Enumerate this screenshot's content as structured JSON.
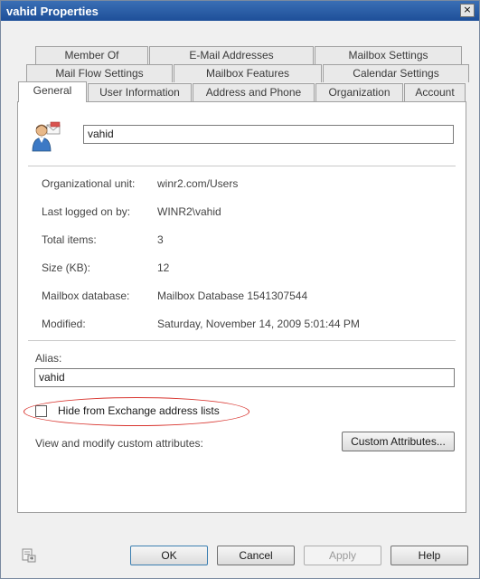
{
  "window": {
    "title": "vahid Properties",
    "close_glyph": "×"
  },
  "tabs": {
    "row1": [
      "Member Of",
      "E-Mail Addresses",
      "Mailbox Settings"
    ],
    "row2": [
      "Mail Flow Settings",
      "Mailbox Features",
      "Calendar Settings"
    ],
    "row3": [
      "General",
      "User Information",
      "Address and Phone",
      "Organization",
      "Account"
    ],
    "active": "General"
  },
  "general": {
    "display_name": "vahid",
    "fields": [
      {
        "label": "Organizational unit:",
        "value": "winr2.com/Users"
      },
      {
        "label": "Last logged on by:",
        "value": "WINR2\\vahid"
      },
      {
        "label": "Total items:",
        "value": "3"
      },
      {
        "label": "Size (KB):",
        "value": "12"
      },
      {
        "label": "Mailbox database:",
        "value": "Mailbox Database 1541307544"
      },
      {
        "label": "Modified:",
        "value": "Saturday, November 14, 2009 5:01:44 PM"
      }
    ],
    "alias_label": "Alias:",
    "alias_value": "vahid",
    "hide_checkbox_label": "Hide from Exchange address lists",
    "hide_checked": false,
    "custom_attr_label": "View and modify custom attributes:",
    "custom_attr_button": "Custom Attributes..."
  },
  "footer": {
    "ok": "OK",
    "cancel": "Cancel",
    "apply": "Apply",
    "help": "Help"
  },
  "icons": {
    "user": "user-mailbox-icon",
    "footer": "properties-page-icon"
  },
  "colors": {
    "titlebar": "#1e4f99",
    "annotation_ellipse": "#d8342e"
  }
}
